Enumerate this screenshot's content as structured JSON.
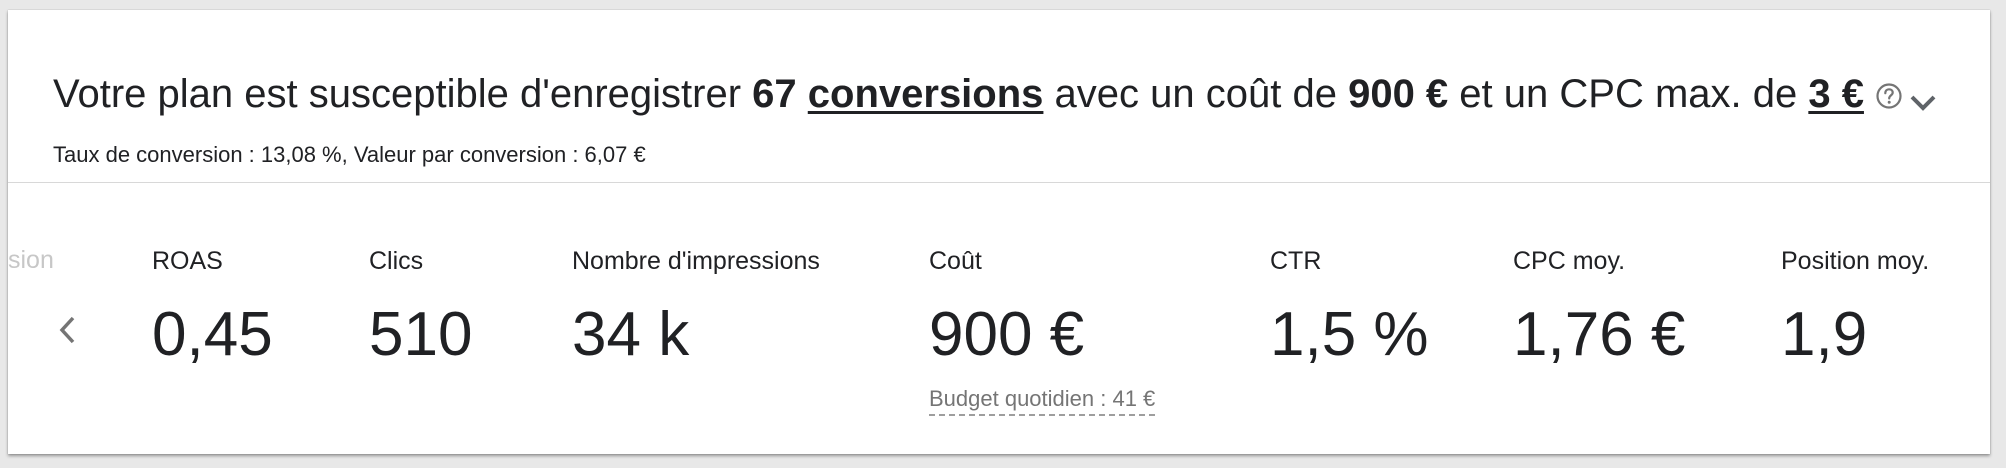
{
  "summary": {
    "prefix": "Votre plan est susceptible d'enregistrer ",
    "conversions_value": "67",
    "conversions_link": "conversions",
    "mid1": " avec un coût de ",
    "cost": "900 €",
    "mid2": " et un CPC max. de ",
    "max_cpc": "3 €",
    "help_icon": "help-circle-icon",
    "expand_icon": "chevron-down-icon"
  },
  "subline": "Taux de conversion : 13,08 %, Valeur par conversion : 6,07 €",
  "metrics": {
    "clipped_label": "sion",
    "prev_icon": "chevron-left-icon",
    "items": [
      {
        "label": "ROAS",
        "value": "0,45"
      },
      {
        "label": "Clics",
        "value": "510"
      },
      {
        "label": "Nombre d'impressions",
        "value": "34 k"
      },
      {
        "label": "Coût",
        "value": "900 €",
        "note": "Budget quotidien : 41 €"
      },
      {
        "label": "CTR",
        "value": "1,5 %"
      },
      {
        "label": "CPC moy.",
        "value": "1,76 €"
      },
      {
        "label": "Position moy.",
        "value": "1,9"
      }
    ]
  }
}
